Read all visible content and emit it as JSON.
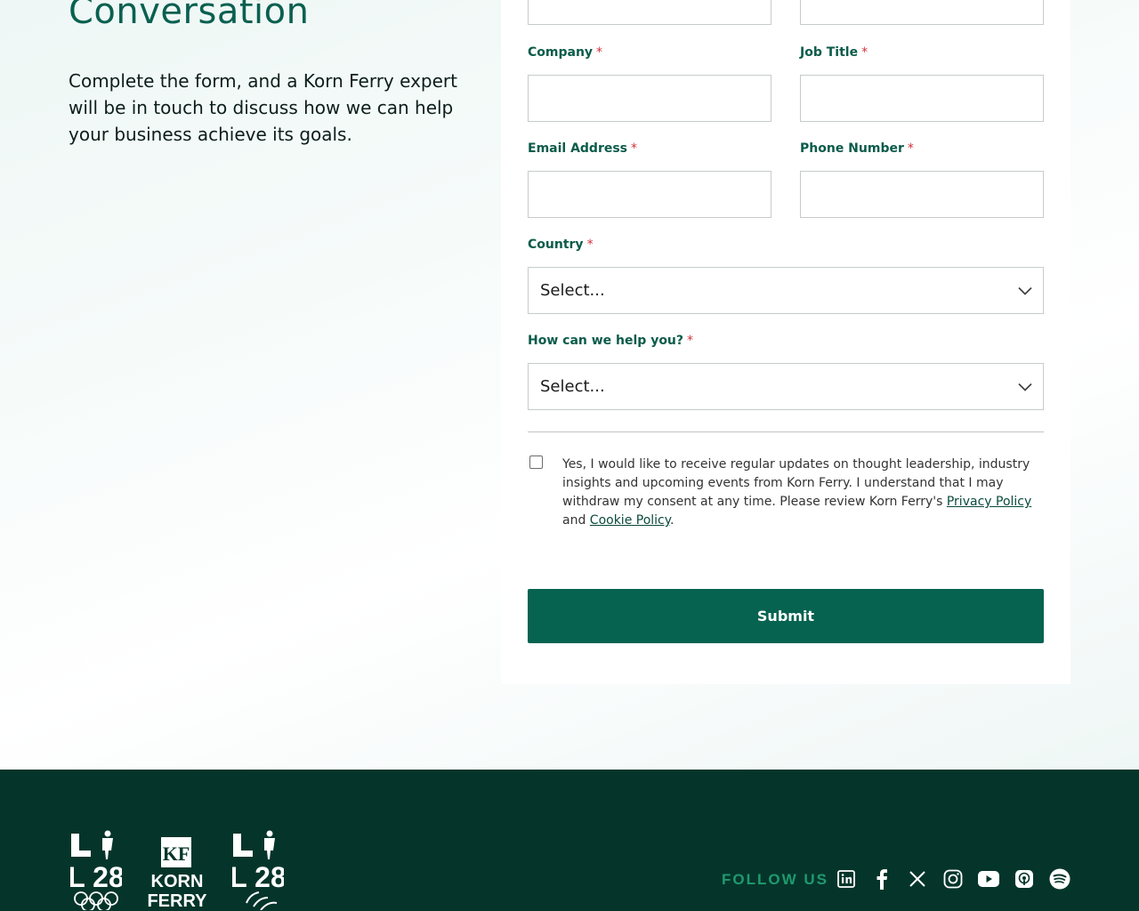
{
  "hero": {
    "title": "Conversation",
    "text": "Complete the form, and a Korn Ferry expert will be in touch to discuss how we can help your business achieve its goals."
  },
  "form": {
    "company_label": "Company",
    "job_title_label": "Job Title",
    "email_label": "Email Address",
    "phone_label": "Phone Number",
    "country_label": "Country",
    "help_label": "How can we help you?",
    "required_mark": "*",
    "country_value": "Select...",
    "help_value": "Select...",
    "consent_text": "Yes, I would like to receive regular updates on thought leadership, industry insights and upcoming events from Korn Ferry. I understand that I may withdraw my consent at any time. Please review Korn Ferry's ",
    "privacy_link": "Privacy Policy",
    "and_text": " and ",
    "cookie_link": "Cookie Policy",
    "period": ".",
    "submit_label": "Submit"
  },
  "footer": {
    "follow_us": "FOLLOW US",
    "logo_left_text": "L 28",
    "logo_center_text_1": "KORN",
    "logo_center_text_2": "FERRY",
    "logo_right_text": "L 28",
    "social_icons": [
      "linkedin-icon",
      "facebook-icon",
      "x-icon",
      "instagram-icon",
      "youtube-icon",
      "apple-podcasts-icon",
      "spotify-icon"
    ]
  },
  "colors": {
    "brand_green": "#066350",
    "footer_bg": "#05352a",
    "follow_green": "#1f9a6f",
    "label_green": "#0b5b4a",
    "required_red": "#d2323a"
  }
}
